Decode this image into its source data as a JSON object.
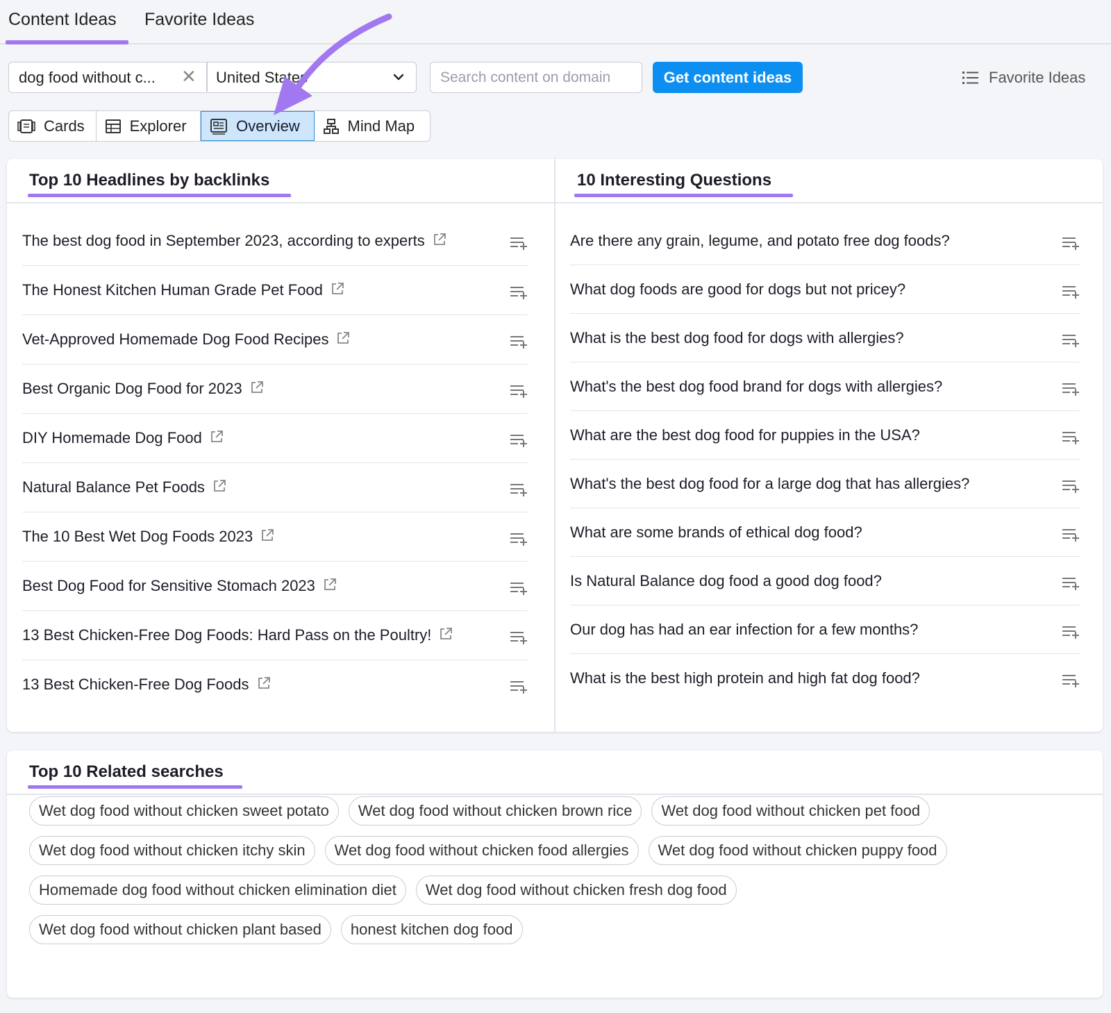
{
  "tabs": [
    "Content Ideas",
    "Favorite Ideas"
  ],
  "search": {
    "keyword": "dog food without c...",
    "database": "United States",
    "domain_placeholder": "Search content on domain",
    "submit_label": "Get content ideas",
    "favorites_label": "Favorite Ideas"
  },
  "views": [
    "Cards",
    "Explorer",
    "Overview",
    "Mind Map"
  ],
  "active_view": "Overview",
  "headlines": {
    "title": "Top 10 Headlines by backlinks",
    "items": [
      "The best dog food in September 2023, according to experts",
      "The Honest Kitchen Human Grade Pet Food",
      "Vet-Approved Homemade Dog Food Recipes",
      "Best Organic Dog Food for 2023",
      "DIY Homemade Dog Food",
      "Natural Balance Pet Foods",
      "The 10 Best Wet Dog Foods 2023",
      "Best Dog Food for Sensitive Stomach 2023",
      "13 Best Chicken-Free Dog Foods: Hard Pass on the Poultry!",
      "13 Best Chicken-Free Dog Foods"
    ]
  },
  "questions": {
    "title": "10 Interesting Questions",
    "items": [
      "Are there any grain, legume, and potato free dog foods?",
      "What dog foods are good for dogs but not pricey?",
      "What is the best dog food for dogs with allergies?",
      "What's the best dog food brand for dogs with allergies?",
      "What are the best dog food for puppies in the USA?",
      "What's the best dog food for a large dog that has allergies?",
      "What are some brands of ethical dog food?",
      "Is Natural Balance dog food a good dog food?",
      "Our dog has had an ear infection for a few months?",
      "What is the best high protein and high fat dog food?"
    ]
  },
  "related": {
    "title": "Top 10 Related searches",
    "rows": [
      [
        "Wet dog food without chicken sweet potato",
        "Wet dog food without chicken brown rice",
        "Wet dog food without chicken pet food"
      ],
      [
        "Wet dog food without chicken itchy skin",
        "Wet dog food without chicken food allergies",
        "Wet dog food without chicken puppy food"
      ],
      [
        "Homemade dog food without chicken elimination diet",
        "Wet dog food without chicken fresh dog food"
      ],
      [
        "Wet dog food without chicken plant based",
        "honest kitchen dog food"
      ]
    ]
  },
  "colors": {
    "accent_purple": "#a178f0",
    "primary_blue": "#0d8ff2",
    "active_view_bg": "#cde6fb"
  },
  "icons": {
    "external_link": "external-link-icon",
    "add_to_list": "add-to-list-icon",
    "clear": "close-icon",
    "dropdown": "chevron-down-icon"
  }
}
